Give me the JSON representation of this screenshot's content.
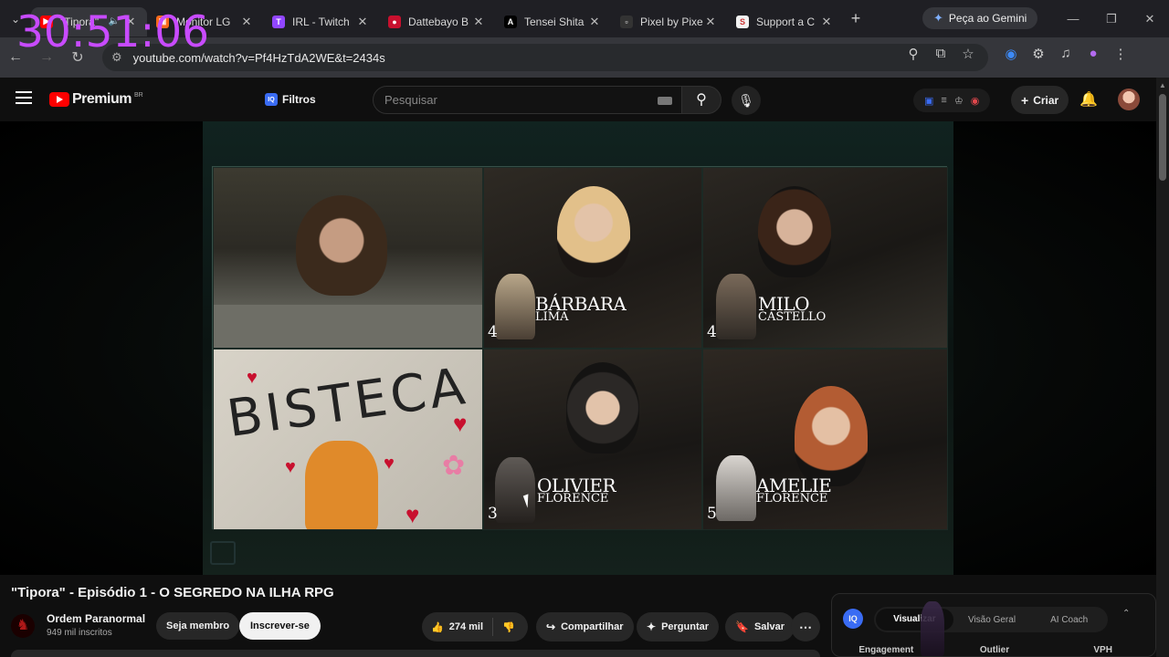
{
  "overlay": {
    "timer": "30:51:06"
  },
  "browser": {
    "tabs": [
      {
        "label": "\"Tipora\"",
        "color": "#ff0000",
        "glyph": "▶",
        "active": true,
        "audio": true
      },
      {
        "label": "Monitor LG",
        "color": "#f96a1c",
        "glyph": "▣"
      },
      {
        "label": "IRL - Twitch",
        "color": "#9146ff",
        "glyph": "T"
      },
      {
        "label": "Dattebayo B",
        "color": "#c8102e",
        "glyph": "●"
      },
      {
        "label": "Tensei Shita",
        "color": "#000000",
        "glyph": "A"
      },
      {
        "label": "Pixel by Pixe",
        "color": "#333333",
        "glyph": "▫"
      },
      {
        "label": "Support a C",
        "color": "#f2f2f2",
        "glyph": "S"
      }
    ],
    "gemini_label": "Peça ao Gemini",
    "url": "youtube.com/watch?v=Pf4HzTdA2WE&t=2434s"
  },
  "youtube": {
    "logo_text": "Premium",
    "logo_country": "BR",
    "filtros_label": "Filtros",
    "search_placeholder": "Pesquisar",
    "criar_label": "Criar",
    "video": {
      "players": [
        {
          "name": "BÁRBARA",
          "surname": "LIMA",
          "number": "4"
        },
        {
          "name": "MILO",
          "surname": "CASTELLO",
          "number": "4"
        },
        {
          "name": "OLIVIER",
          "surname": "FLORENCE",
          "number": "3"
        },
        {
          "name": "AMELIE",
          "surname": "FLORENCE",
          "number": "5"
        }
      ],
      "drawing_text": "BISTECA"
    },
    "title": "\"Tipora\" - Episódio 1 - O SEGREDO NA ILHA RPG",
    "channel": {
      "name": "Ordem Paranormal",
      "subscribers": "949 mil inscritos"
    },
    "buttons": {
      "membro": "Seja membro",
      "inscrever": "Inscrever-se",
      "likes": "274 mil",
      "compartilhar": "Compartilhar",
      "perguntar": "Perguntar",
      "salvar": "Salvar"
    },
    "vidiq": {
      "tabs": [
        "Visualizar",
        "Visão Geral",
        "AI Coach"
      ],
      "metrics": [
        "Engagement",
        "Outlier",
        "VPH"
      ]
    }
  }
}
